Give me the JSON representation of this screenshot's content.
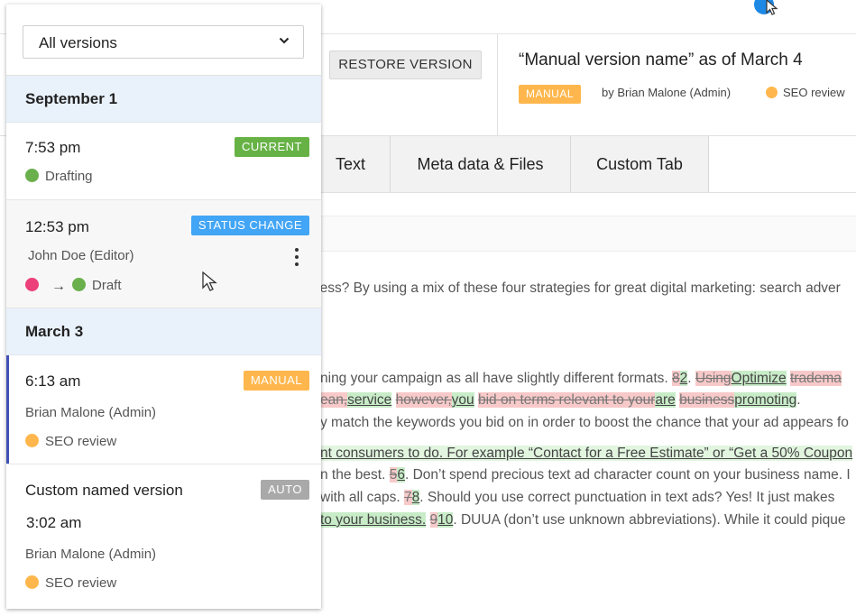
{
  "panel": {
    "filter": {
      "selected": "All versions"
    },
    "groups": [
      {
        "date": "September 1",
        "items": [
          {
            "time": "7:53 pm",
            "badge": "CURRENT",
            "status": "Drafting"
          },
          {
            "time": "12:53 pm",
            "badge": "STATUS CHANGE",
            "author": "John Doe (Editor)",
            "status_to": "Draft"
          }
        ]
      },
      {
        "date": "March 3",
        "items": [
          {
            "time": "6:13 am",
            "badge": "MANUAL",
            "author": "Brian Malone (Admin)",
            "status": "SEO review"
          },
          {
            "name": "Custom named version",
            "time": "3:02 am",
            "badge": "AUTO",
            "author": "Brian Malone (Admin)",
            "status": "SEO review"
          }
        ]
      }
    ]
  },
  "header": {
    "restore_label": "RESTORE VERSION",
    "version_title": "“Manual version name” as of March 4",
    "badge": "MANUAL",
    "author": "by Brian Malone (Admin)",
    "status": "SEO review"
  },
  "tabs": [
    {
      "label": "Text"
    },
    {
      "label": "Meta data & Files"
    },
    {
      "label": "Custom Tab"
    }
  ],
  "content": {
    "line1": "ness? By using a mix of these four strategies for great digital marketing: search adver",
    "line2": {
      "a": "ning your campaign as all have slightly different formats. ",
      "del1": "8",
      "ins1": "2",
      "b": ". ",
      "del2": "Using",
      "ins2": "Optimize",
      "c": " ",
      "del3": "tradema"
    },
    "line3": {
      "del1": "ean,",
      "ins1": "service",
      "a": " ",
      "del2": "however,",
      "ins2": "you",
      "b": " ",
      "del3": "bid on terms relevant to your",
      "ins3": "are",
      "c": " ",
      "del4": "business",
      "ins4": "promoting",
      "d": "."
    },
    "line4": "y match the keywords you bid on in order to boost the chance that your ad appears fo",
    "line5": "nt consumers to do. For example “Contact for a Free Estimate” or “Get a 50% Coupon",
    "line6": {
      "a": "n the best. ",
      "del1": "5",
      "ins1": "6",
      "b": ". Don’t spend precious text ad character count on your business name. I"
    },
    "line7": {
      "a": " with all caps. ",
      "del1": "7",
      "ins1": "8",
      "b": ". Should you use correct punctuation in text ads? Yes! It just makes"
    },
    "line8": {
      "ins0": " to your business.",
      "a": " ",
      "del1": "9",
      "ins1": "10",
      "b": ". DUUA (don’t use unknown abbreviations). While it could pique"
    }
  }
}
